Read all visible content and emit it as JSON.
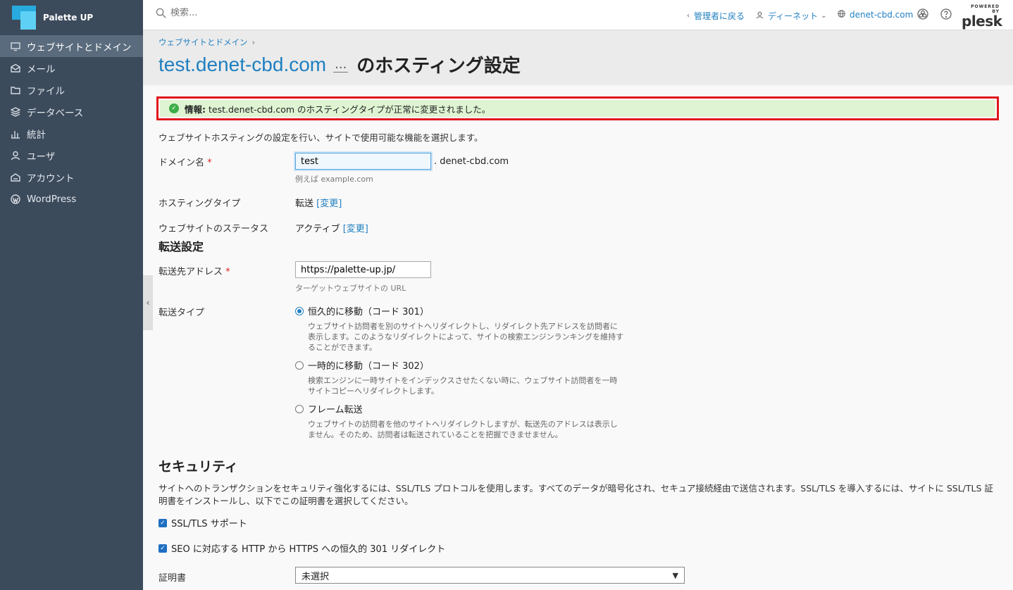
{
  "brand": {
    "name": "Palette UP"
  },
  "sidebar": {
    "items": [
      {
        "label": "ウェブサイトとドメイン",
        "icon": "monitor-icon",
        "active": true
      },
      {
        "label": "メール",
        "icon": "mail-icon",
        "active": false
      },
      {
        "label": "ファイル",
        "icon": "folder-icon",
        "active": false
      },
      {
        "label": "データベース",
        "icon": "database-icon",
        "active": false
      },
      {
        "label": "統計",
        "icon": "chart-icon",
        "active": false
      },
      {
        "label": "ユーザ",
        "icon": "user-icon",
        "active": false
      },
      {
        "label": "アカウント",
        "icon": "account-icon",
        "active": false
      },
      {
        "label": "WordPress",
        "icon": "wordpress-icon",
        "active": false
      }
    ]
  },
  "topbar": {
    "search_placeholder": "検索...",
    "back_admin": "管理者に戻る",
    "user": "ディーネット",
    "domain": "denet-cbd.com",
    "plesk_powered": "POWERED BY",
    "plesk_name": "plesk"
  },
  "header": {
    "breadcrumb": "ウェブサイトとドメイン",
    "title_domain": "test.denet-cbd.com",
    "title_dots": "...",
    "title_rest": "のホスティング設定"
  },
  "alert": {
    "label": "情報:",
    "message": "test.denet-cbd.com のホスティングタイプが正常に変更されました。",
    "color": "#dff4d2"
  },
  "form": {
    "intro": "ウェブサイトホスティングの設定を行い、サイトで使用可能な機能を選択します。",
    "domain_label": "ドメイン名",
    "domain_value": "test",
    "domain_suffix": ". denet-cbd.com",
    "domain_hint": "例えば example.com",
    "hosting_type_label": "ホスティングタイプ",
    "hosting_type_value": "転送",
    "change_link": "[変更]",
    "status_label": "ウェブサイトのステータス",
    "status_value": "アクティブ",
    "forward_title": "転送設定",
    "forward_address_label": "転送先アドレス",
    "forward_address_value": "https://palette-up.jp/",
    "forward_address_hint": "ターゲットウェブサイトの URL",
    "forward_type_label": "転送タイプ",
    "forward_types": [
      {
        "label": "恒久的に移動（コード 301）",
        "desc": "ウェブサイト訪問者を別のサイトへリダイレクトし、リダイレクト先アドレスを訪問者に表示します。このようなリダイレクトによって、サイトの検索エンジンランキングを維持することができます。",
        "checked": true
      },
      {
        "label": "一時的に移動（コード 302）",
        "desc": "検索エンジンに一時サイトをインデックスさせたくない時に、ウェブサイト訪問者を一時サイトコピーへリダイレクトします。",
        "checked": false
      },
      {
        "label": "フレーム転送",
        "desc": "ウェブサイトの訪問者を他のサイトへリダイレクトしますが、転送先のアドレスは表示しません。そのため、訪問者は転送されていることを把握できませません。",
        "checked": false
      }
    ],
    "security_title": "セキュリティ",
    "security_desc": "サイトへのトランザクションをセキュリティ強化するには、SSL/TLS プロトコルを使用します。すべてのデータが暗号化され、セキュア接続経由で送信されます。SSL/TLS を導入するには、サイトに SSL/TLS 証明書をインストールし、以下でこの証明書を選択してください。",
    "ssl_support": "SSL/TLS サポート",
    "seo_redirect": "SEO に対応する HTTP から HTTPS への恒久的 301 リダイレクト",
    "cert_label": "証明書",
    "cert_value": "未選択"
  }
}
